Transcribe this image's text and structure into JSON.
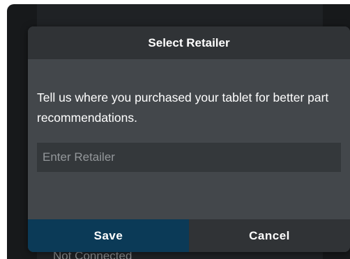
{
  "background": {
    "status_text": "Not Connected"
  },
  "dialog": {
    "title": "Select Retailer",
    "message": "Tell us where you purchased your tablet for better part recommendations.",
    "retailer_input": {
      "value": "",
      "placeholder": "Enter Retailer"
    },
    "save_label": "Save",
    "cancel_label": "Cancel"
  },
  "colors": {
    "header_bg": "#303336",
    "dialog_bg": "#43474b",
    "save_bg": "#0b3a57",
    "cancel_bg": "#303336"
  }
}
